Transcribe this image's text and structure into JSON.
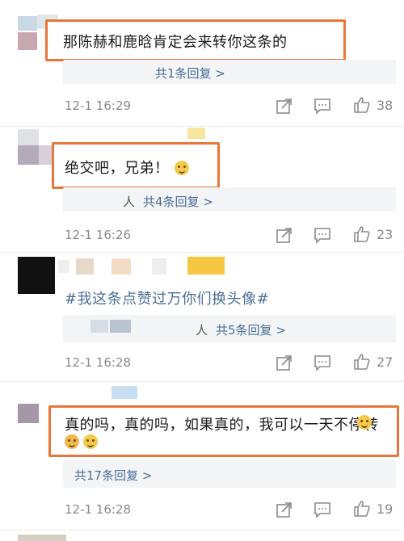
{
  "comments": [
    {
      "text": "那陈赫和鹿晗肯定会来转你这条的",
      "reply_link": "共1条回复 >",
      "reply_prefix": "",
      "timestamp": "12-1 16:29",
      "likes": "38"
    },
    {
      "text": "绝交吧，兄弟！",
      "reply_link": "共4条回复 >",
      "reply_prefix": "人",
      "timestamp": "12-1 16:26",
      "likes": "23"
    },
    {
      "text": "#我这条点赞过万你们换头像#",
      "reply_link": "共5条回复 >",
      "reply_prefix": "人",
      "timestamp": "12-1 16:28",
      "likes": "27"
    },
    {
      "text": "真的吗，真的吗，如果真的，我可以一天不停转",
      "reply_link": "共17条回复 >",
      "reply_prefix": "",
      "timestamp": "12-1 16:28",
      "likes": "19"
    }
  ],
  "icons": {
    "share": "share-icon",
    "comment": "comment-icon",
    "like": "thumbs-up-icon",
    "emoji": "smiley-emoji-icon"
  },
  "colors": {
    "highlight_border": "#e8763a",
    "link": "#4a6e96",
    "meta": "#8a8a8a",
    "reply_bg": "#f3f4f6"
  }
}
